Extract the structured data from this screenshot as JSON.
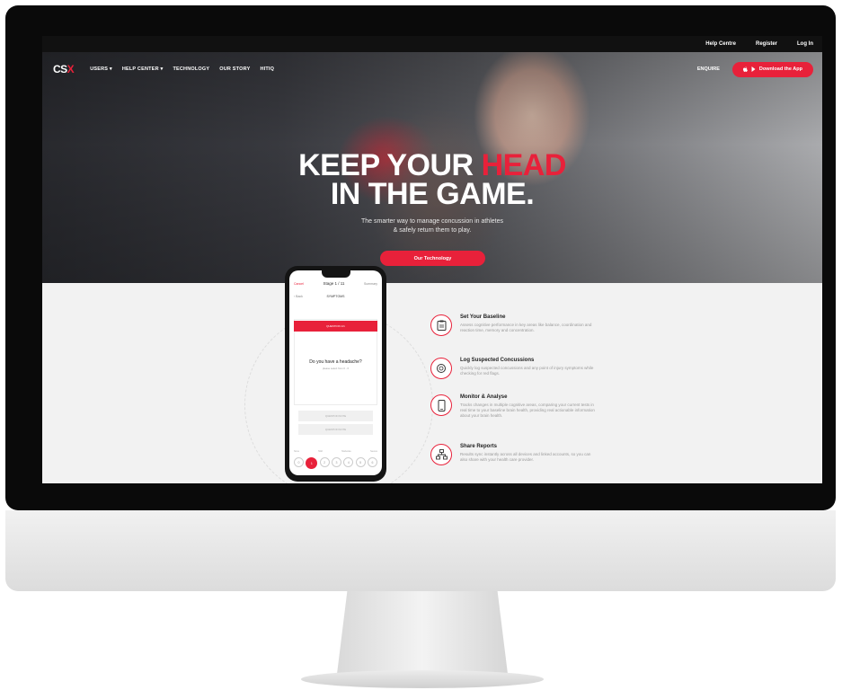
{
  "topbar": {
    "links": [
      "Help Centre",
      "Register",
      "Log In"
    ]
  },
  "nav": {
    "logo_left": "CS",
    "logo_accent": "X",
    "items": [
      "USERS ▾",
      "HELP CENTER ▾",
      "TECHNOLOGY",
      "OUR STORY",
      "HITIQ"
    ],
    "enquire": "ENQUIRE",
    "download_label": "Download the App"
  },
  "hero": {
    "title_line1_white": "KEEP YOUR ",
    "title_line1_red": "HEAD",
    "title_line2": "IN THE GAME.",
    "subtitle_line1": "The smarter way to manage concussion in athletes",
    "subtitle_line2": "& safely return them to play.",
    "cta_label": "Our Technology"
  },
  "phone": {
    "header_left": "Cancel",
    "header_title": "Stage 1 / 11",
    "header_right": "Summary",
    "sub_left": "‹ Back",
    "sub_title": "SYMPTOMS",
    "question_bar": "QUESTION 1/1",
    "question": "Do you have a headache?",
    "question_sub": "please select from 0 - 6",
    "option_1": "QUESTION NOTE",
    "option_2": "QUESTION NOTE",
    "scale_labels": [
      "None",
      "Mild",
      "Moderate",
      "Severe"
    ],
    "scale": [
      "0",
      "1",
      "2",
      "3",
      "4",
      "5",
      "6"
    ]
  },
  "features": [
    {
      "title": "Set Your Baseline",
      "desc": "Assess cognitive performance in key areas like balance, coordination and reaction time, memory and concentration.",
      "icon": "clipboard-icon"
    },
    {
      "title": "Log Suspected Concussions",
      "desc": "Quickly log suspected concussions and any point of injury symptoms while checking for red flags.",
      "icon": "head-icon"
    },
    {
      "title": "Monitor & Analyse",
      "desc": "Tracks changes in multiple cognitive areas, comparing your current tests in real time to your baseline brain health, providing real actionable information about your brain health.",
      "icon": "phone-icon"
    },
    {
      "title": "Share Reports",
      "desc": "Results sync instantly across all devices and linked accounts, so you can also share with your health care provider.",
      "icon": "network-icon"
    }
  ],
  "colors": {
    "accent": "#e8213a",
    "topbar": "#111111",
    "bezel": "#0a0a0a"
  }
}
